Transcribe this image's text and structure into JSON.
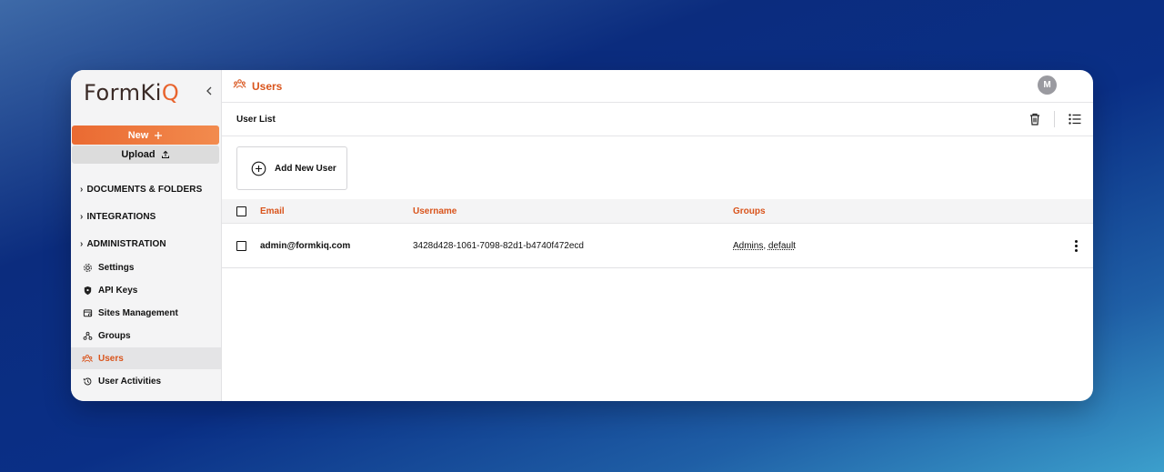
{
  "app": {
    "logo_prefix": "FormKi",
    "logo_accent": "Q",
    "brand_color": "#e8642e",
    "accent_text_color": "#d9541c"
  },
  "sidebar": {
    "new_label": "New",
    "upload_label": "Upload",
    "sections": [
      {
        "label": "DOCUMENTS & FOLDERS"
      },
      {
        "label": "INTEGRATIONS"
      },
      {
        "label": "ADMINISTRATION"
      }
    ],
    "items": [
      {
        "label": "Settings",
        "icon": "gear-icon"
      },
      {
        "label": "API Keys",
        "icon": "shield-icon"
      },
      {
        "label": "Sites Management",
        "icon": "sites-icon"
      },
      {
        "label": "Groups",
        "icon": "groups-icon"
      },
      {
        "label": "Users",
        "icon": "users-icon",
        "active": true
      },
      {
        "label": "User Activities",
        "icon": "history-icon"
      }
    ]
  },
  "header": {
    "title": "Users",
    "avatar_initial": "M"
  },
  "subheader": {
    "title": "User List"
  },
  "actions": {
    "add_user_label": "Add New User"
  },
  "table": {
    "columns": [
      "Email",
      "Username",
      "Groups"
    ],
    "rows": [
      {
        "email": "admin@formkiq.com",
        "username": "3428d428-1061-7098-82d1-b4740f472ecd",
        "groups": [
          "Admins",
          "default"
        ]
      }
    ]
  }
}
